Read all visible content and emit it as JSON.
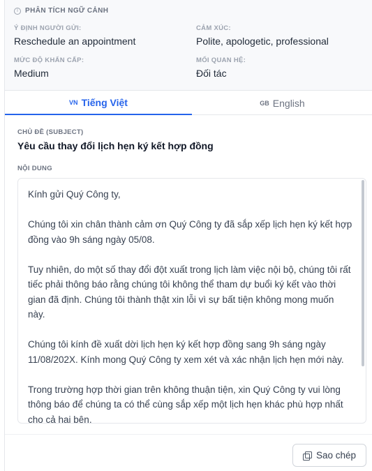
{
  "analysis": {
    "title": "PHÂN TÍCH NGỮ CẢNH",
    "sender_intent": {
      "label": "Ý ĐỊNH NGƯỜI GỬI:",
      "value": "Reschedule an appointment"
    },
    "emotion": {
      "label": "CẢM XÚC:",
      "value": "Polite, apologetic, professional"
    },
    "urgency": {
      "label": "MỨC ĐỘ KHẨN CẤP:",
      "value": "Medium"
    },
    "relationship": {
      "label": "MỐI QUAN HỆ:",
      "value": "Đối tác"
    }
  },
  "tabs": [
    {
      "flag": "VN",
      "label": "Tiếng Việt",
      "active": true
    },
    {
      "flag": "GB",
      "label": "English",
      "active": false
    }
  ],
  "subject": {
    "label": "CHỦ ĐỀ (SUBJECT)",
    "value": "Yêu cầu thay đổi lịch hẹn ký kết hợp đồng"
  },
  "content": {
    "label": "NỘI DUNG",
    "paragraphs": [
      "Kính gửi Quý Công ty,",
      "Chúng tôi xin chân thành cảm ơn Quý Công ty đã sắp xếp lịch hẹn ký kết hợp đồng vào 9h sáng ngày 05/08.",
      "Tuy nhiên, do một số thay đổi đột xuất trong lịch làm việc nội bộ, chúng tôi rất tiếc phải thông báo rằng chúng tôi không thể tham dự buổi ký kết vào thời gian đã định. Chúng tôi thành thật xin lỗi vì sự bất tiện không mong muốn này.",
      "Chúng tôi kính đề xuất dời lịch hẹn ký kết hợp đồng sang 9h sáng ngày 11/08/202X. Kính mong Quý Công ty xem xét và xác nhận lịch hẹn mới này.",
      "Trong trường hợp thời gian trên không thuận tiện, xin Quý Công ty vui lòng thông báo để chúng ta có thể cùng sắp xếp một lịch hẹn khác phù hợp nhất cho cả hai bên."
    ]
  },
  "copy_button": {
    "label": "Sao chép",
    "icon": "copy-icon"
  },
  "colors": {
    "accent": "#2563eb",
    "muted": "#6b7280",
    "border": "#e5e7eb"
  }
}
